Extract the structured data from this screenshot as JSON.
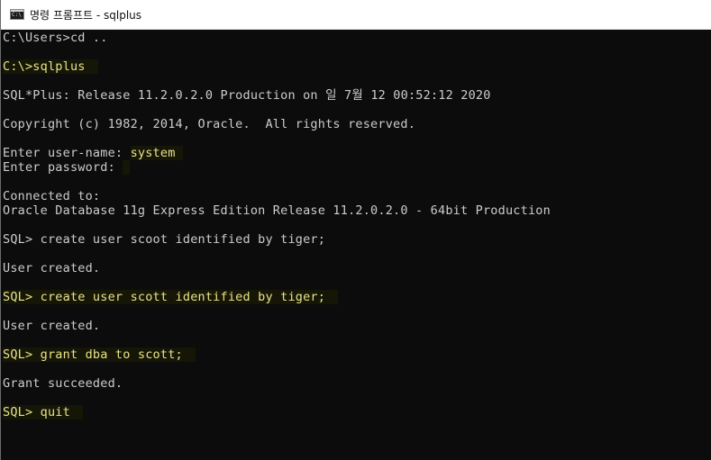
{
  "window": {
    "title": "명령 프롬프트 - sqlplus",
    "icon": "cmd-icon"
  },
  "console": {
    "lines": [
      {
        "text": "C:\\Users>cd ..",
        "highlight": false
      },
      {
        "text": "",
        "highlight": false
      },
      {
        "text": "C:\\>sqlplus",
        "highlight": true
      },
      {
        "text": "",
        "highlight": false
      },
      {
        "text": "SQL*Plus: Release 11.2.0.2.0 Production on 일 7월 12 00:52:12 2020",
        "highlight": false
      },
      {
        "text": "",
        "highlight": false
      },
      {
        "text": "Copyright (c) 1982, 2014, Oracle.  All rights reserved.",
        "highlight": false
      },
      {
        "text": "",
        "highlight": false
      },
      {
        "prefix": "Enter user-name: ",
        "input": "system",
        "highlight": "input"
      },
      {
        "prefix": "Enter password: ",
        "input": "",
        "highlight": "input"
      },
      {
        "text": "",
        "highlight": false
      },
      {
        "text": "Connected to:",
        "highlight": false
      },
      {
        "text": "Oracle Database 11g Express Edition Release 11.2.0.2.0 - 64bit Production",
        "highlight": false
      },
      {
        "text": "",
        "highlight": false
      },
      {
        "text": "SQL> create user scoot identified by tiger;",
        "highlight": false
      },
      {
        "text": "",
        "highlight": false
      },
      {
        "text": "User created.",
        "highlight": false
      },
      {
        "text": "",
        "highlight": false
      },
      {
        "text": "SQL> create user scott identified by tiger;",
        "highlight": true
      },
      {
        "text": "",
        "highlight": false
      },
      {
        "text": "User created.",
        "highlight": false
      },
      {
        "text": "",
        "highlight": false
      },
      {
        "text": "SQL> grant dba to scott;",
        "highlight": true
      },
      {
        "text": "",
        "highlight": false
      },
      {
        "text": "Grant succeeded.",
        "highlight": false
      },
      {
        "text": "",
        "highlight": false
      },
      {
        "text": "SQL> quit",
        "highlight": true
      }
    ]
  },
  "colors": {
    "console_bg": "#0c0c0c",
    "console_text": "#cccccc",
    "highlight_text": "#e8e48a",
    "highlight_bg": "#161606"
  }
}
